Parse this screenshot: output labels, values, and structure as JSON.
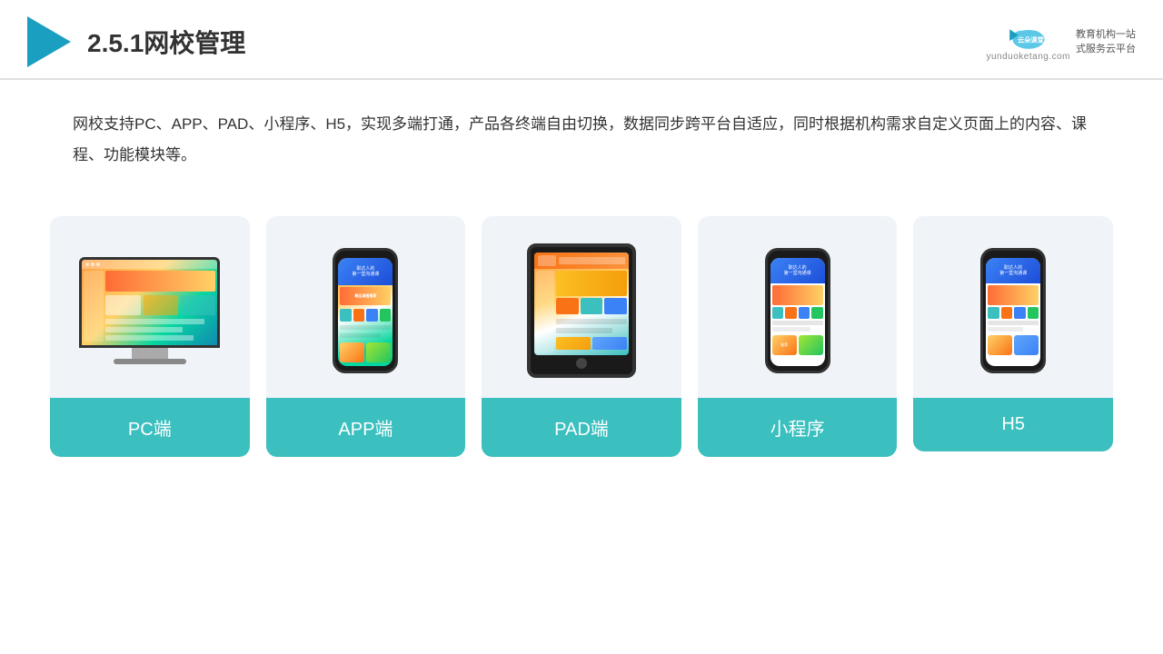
{
  "header": {
    "title": "2.5.1网校管理",
    "brand_name": "云朵课堂",
    "brand_url": "yunduoketang.com",
    "brand_tagline_line1": "教育机构一站",
    "brand_tagline_line2": "式服务云平台"
  },
  "description": {
    "text": "网校支持PC、APP、PAD、小程序、H5，实现多端打通，产品各终端自由切换，数据同步跨平台自适应，同时根据机构需求自定义页面上的内容、课程、功能模块等。"
  },
  "cards": [
    {
      "id": "pc",
      "label": "PC端"
    },
    {
      "id": "app",
      "label": "APP端"
    },
    {
      "id": "pad",
      "label": "PAD端"
    },
    {
      "id": "mini",
      "label": "小程序"
    },
    {
      "id": "h5",
      "label": "H5"
    }
  ],
  "colors": {
    "accent": "#3bbfbf",
    "header_line": "#e0e0e0",
    "card_bg": "#f0f4f8",
    "title_color": "#333333",
    "text_color": "#333333"
  }
}
